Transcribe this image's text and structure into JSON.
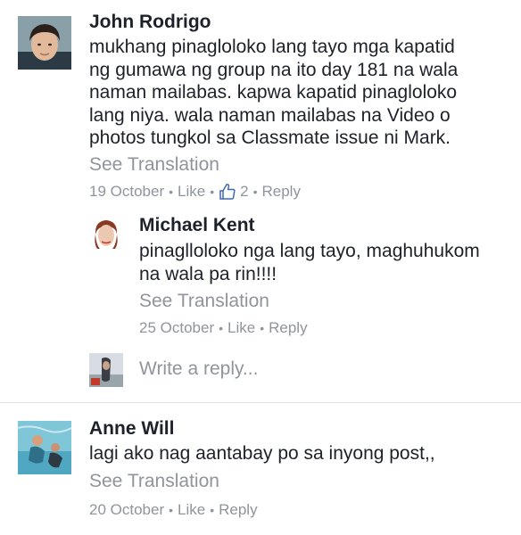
{
  "comments": [
    {
      "author": "John Rodrigo",
      "lines": [
        "mukhang pinagloloko lang tayo mga kapatid",
        "ng gumawa ng group na ito day 181 na wala",
        "naman mailabas. kapwa kapatid pinagloloko",
        "lang niya. wala naman mailabas na Video o",
        "photos tungkol sa Classmate issue ni Mark."
      ],
      "see_translation": "See Translation",
      "date": "19 October",
      "like": "Like",
      "like_count": "2",
      "reply": "Reply",
      "like_icon": "thumbs-up-icon"
    },
    {
      "author": "Michael Kent",
      "lines": [
        "pinaglloloko nga lang tayo, maghuhukom",
        "na wala pa rin!!!!"
      ],
      "see_translation": "See Translation",
      "date": "25 October",
      "like": "Like",
      "reply": "Reply"
    },
    {
      "author": "Anne Will",
      "lines": [
        "lagi ako nag aantabay po sa inyong post,,"
      ],
      "see_translation": "See Translation",
      "date": "20 October",
      "like": "Like",
      "reply": "Reply"
    }
  ],
  "reply_box": {
    "placeholder": "Write a reply..."
  },
  "colors": {
    "text": "#1d2129",
    "secondary": "#90949c",
    "divider": "#dddfe2",
    "like_blue": "#4267b2"
  }
}
